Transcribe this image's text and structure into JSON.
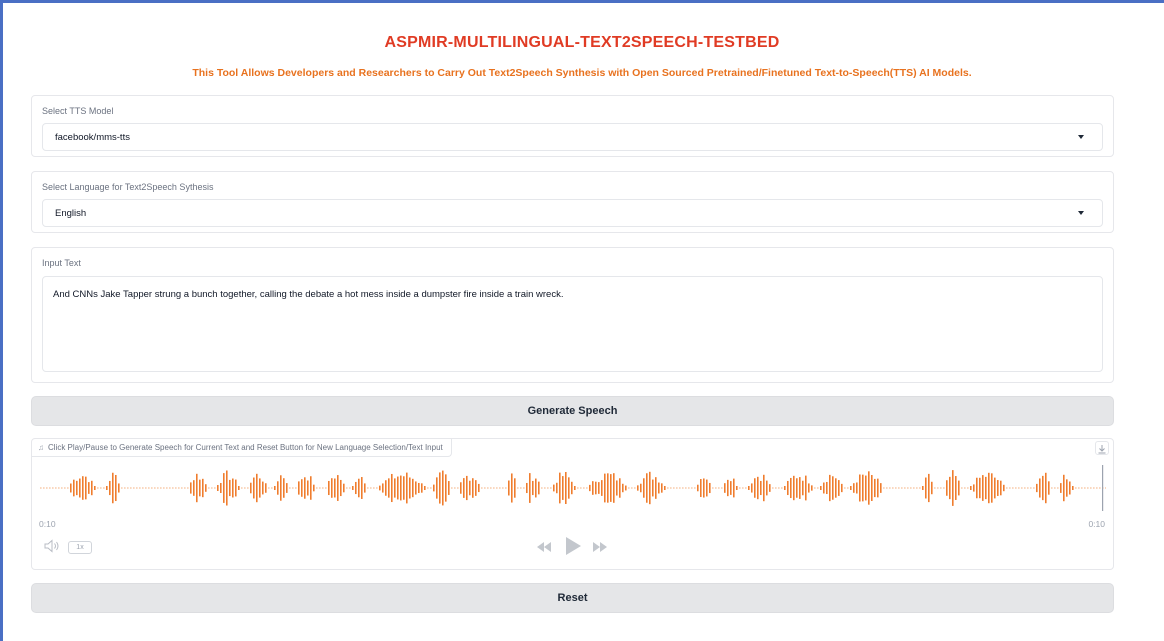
{
  "header": {
    "title": "ASPMIR-MULTILINGUAL-TEXT2SPEECH-TESTBED",
    "subtitle": "This Tool Allows Developers and Researchers to Carry Out Text2Speech Synthesis with Open Sourced Pretrained/Finetuned Text-to-Speech(TTS) AI Models."
  },
  "model_select": {
    "label": "Select TTS Model",
    "value": "facebook/mms-tts"
  },
  "language_select": {
    "label": "Select Language for Text2Speech Sythesis",
    "value": "English"
  },
  "input_text": {
    "label": "Input Text",
    "value": "And CNNs Jake Tapper strung a bunch together, calling the debate a hot mess inside a dumpster fire inside a train wreck."
  },
  "generate_button": {
    "label": "Generate Speech"
  },
  "audio": {
    "label": "Click Play/Pause to Generate Speech for Current Text and Reset Button for New Language Selection/Text Input",
    "current_time": "0:10",
    "duration": "0:10",
    "playback_rate": "1x",
    "wave_color": "#ef7d2e",
    "icons": [
      "music-note-icon",
      "download-icon",
      "volume-icon",
      "skip-back-icon",
      "play-icon",
      "skip-forward-icon"
    ]
  },
  "reset_button": {
    "label": "Reset"
  },
  "colors": {
    "title": "#e03b24",
    "subtitle": "#e8721f",
    "frame": "#4a6fc4",
    "button_bg": "#e5e6e8"
  }
}
